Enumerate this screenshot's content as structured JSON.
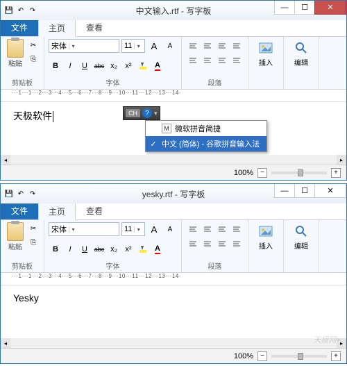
{
  "windows": [
    {
      "title": "中文输入.rtf - 写字板",
      "close_style": "red",
      "doc_text": "天极软件",
      "show_cursor": true,
      "show_ime": true,
      "zoom_text": "100%"
    },
    {
      "title": "yesky.rtf - 写字板",
      "close_style": "plain",
      "doc_text": "Yesky",
      "show_cursor": false,
      "show_ime": false,
      "zoom_text": "100%"
    }
  ],
  "qat": {
    "save_icon": "💾",
    "undo_icon": "↶",
    "redo_icon": "↷"
  },
  "tabs": {
    "file": "文件",
    "home": "主页",
    "view": "查看"
  },
  "ribbon": {
    "clipboard_label": "剪贴板",
    "paste_label": "粘贴",
    "font_label": "字体",
    "font_name": "宋体",
    "font_size": "11",
    "grow": "A",
    "shrink": "A",
    "bold": "B",
    "italic": "I",
    "underline": "U",
    "strike": "abc",
    "sub": "x₂",
    "sup": "x²",
    "para_label": "段落",
    "insert_label": "插入",
    "edit_label": "编辑"
  },
  "ruler_text": "···1···1···2···3···4···5···6···7···8···9···10···11···12···13···14·",
  "ime": {
    "badge": "CH",
    "options": [
      {
        "check": "",
        "badge": "M",
        "label": "微软拼音简捷",
        "selected": false
      },
      {
        "check": "✓",
        "badge": "",
        "label": "中文 (简体) - 谷歌拼音输入法",
        "selected": true
      }
    ]
  },
  "winbtns": {
    "min": "—",
    "max": "☐",
    "close": "✕"
  },
  "watermark": "天極网+"
}
